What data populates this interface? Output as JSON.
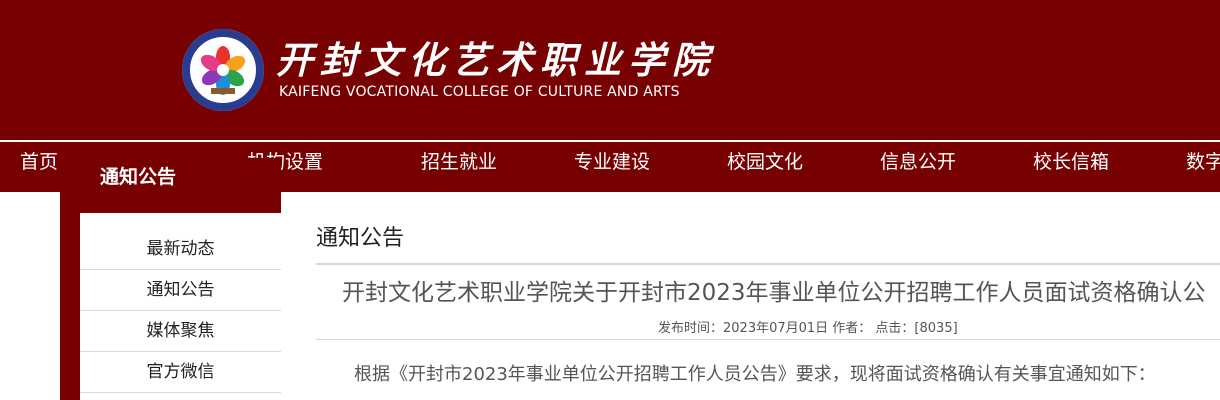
{
  "header": {
    "school_name_cn": "开封文化艺术职业学院",
    "school_name_en": "KAIFENG VOCATIONAL COLLEGE OF CULTURE AND ARTS",
    "logo_icon": "school-emblem-icon",
    "bg_color": "#770000"
  },
  "nav": {
    "items": [
      {
        "label": "首页"
      },
      {
        "label": "机构设置"
      },
      {
        "label": "招生就业"
      },
      {
        "label": "专业建设"
      },
      {
        "label": "校园文化"
      },
      {
        "label": "信息公开"
      },
      {
        "label": "校长信箱"
      },
      {
        "label": "数字"
      }
    ]
  },
  "sidebar": {
    "title": "通知公告",
    "items": [
      {
        "label": "最新动态"
      },
      {
        "label": "通知公告"
      },
      {
        "label": "媒体聚焦"
      },
      {
        "label": "官方微信"
      }
    ]
  },
  "main": {
    "section_title": "通知公告",
    "article": {
      "title": "开封文化艺术职业学院关于开封市2023年事业单位公开招聘工作人员面试资格确认公",
      "meta": "发布时间：2023年07月01日 作者： 点击：[8035]",
      "body_first_line": "根据《开封市2023年事业单位公开招聘工作人员公告》要求，现将面试资格确认有关事宜通知如下："
    }
  }
}
